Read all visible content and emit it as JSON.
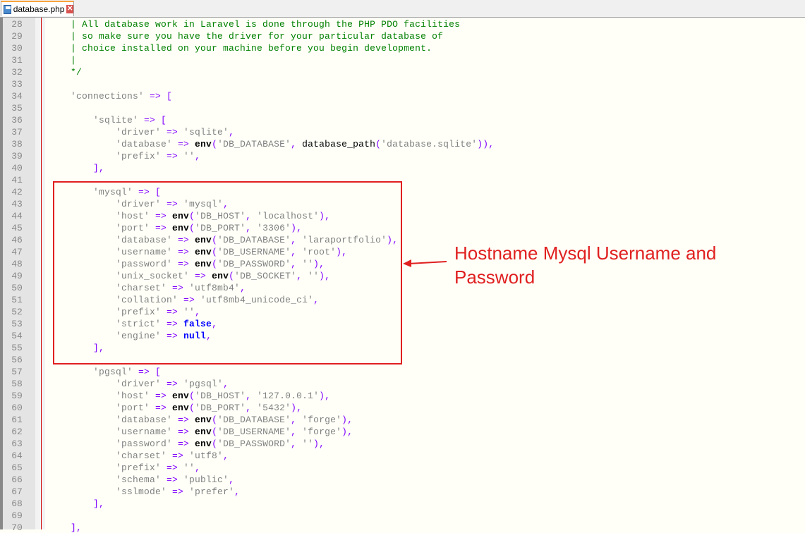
{
  "tab": {
    "title": "database.php",
    "icon": "save-icon",
    "close": "close-icon"
  },
  "annotation": {
    "text_line1": "Hostname Mysql Username and",
    "text_line2": "Password",
    "color": "#e02020"
  },
  "first_line_number": 28,
  "lines": [
    [
      [
        "c",
        "    | All database work in Laravel is done through the PHP PDO facilities"
      ]
    ],
    [
      [
        "c",
        "    | so make sure you have the driver for your particular database of"
      ]
    ],
    [
      [
        "c",
        "    | choice installed on your machine before you begin development."
      ]
    ],
    [
      [
        "c",
        "    |"
      ]
    ],
    [
      [
        "c",
        "    */"
      ]
    ],
    [],
    [
      [
        "s",
        "    'connections'"
      ],
      [
        "o",
        " => ["
      ]
    ],
    [],
    [
      [
        "s",
        "        'sqlite'"
      ],
      [
        "o",
        " => ["
      ]
    ],
    [
      [
        "s",
        "            'driver'"
      ],
      [
        "o",
        " => "
      ],
      [
        "s",
        "'sqlite'"
      ],
      [
        "o",
        ","
      ]
    ],
    [
      [
        "s",
        "            'database'"
      ],
      [
        "o",
        " => "
      ],
      [
        "f",
        "env"
      ],
      [
        "o",
        "("
      ],
      [
        "s",
        "'DB_DATABASE'"
      ],
      [
        "o",
        ", "
      ],
      [
        "p",
        "database_path"
      ],
      [
        "o",
        "("
      ],
      [
        "s",
        "'database.sqlite'"
      ],
      [
        "o",
        ")),"
      ]
    ],
    [
      [
        "s",
        "            'prefix'"
      ],
      [
        "o",
        " => "
      ],
      [
        "s",
        "''"
      ],
      [
        "o",
        ","
      ]
    ],
    [
      [
        "o",
        "        ],"
      ]
    ],
    [],
    [
      [
        "s",
        "        'mysql'"
      ],
      [
        "o",
        " => ["
      ]
    ],
    [
      [
        "s",
        "            'driver'"
      ],
      [
        "o",
        " => "
      ],
      [
        "s",
        "'mysql'"
      ],
      [
        "o",
        ","
      ]
    ],
    [
      [
        "s",
        "            'host'"
      ],
      [
        "o",
        " => "
      ],
      [
        "f",
        "env"
      ],
      [
        "o",
        "("
      ],
      [
        "s",
        "'DB_HOST'"
      ],
      [
        "o",
        ", "
      ],
      [
        "s",
        "'localhost'"
      ],
      [
        "o",
        "),"
      ]
    ],
    [
      [
        "s",
        "            'port'"
      ],
      [
        "o",
        " => "
      ],
      [
        "f",
        "env"
      ],
      [
        "o",
        "("
      ],
      [
        "s",
        "'DB_PORT'"
      ],
      [
        "o",
        ", "
      ],
      [
        "s",
        "'3306'"
      ],
      [
        "o",
        "),"
      ]
    ],
    [
      [
        "s",
        "            'database'"
      ],
      [
        "o",
        " => "
      ],
      [
        "f",
        "env"
      ],
      [
        "o",
        "("
      ],
      [
        "s",
        "'DB_DATABASE'"
      ],
      [
        "o",
        ", "
      ],
      [
        "s",
        "'laraportfolio'"
      ],
      [
        "o",
        "),"
      ]
    ],
    [
      [
        "s",
        "            'username'"
      ],
      [
        "o",
        " => "
      ],
      [
        "f",
        "env"
      ],
      [
        "o",
        "("
      ],
      [
        "s",
        "'DB_USERNAME'"
      ],
      [
        "o",
        ", "
      ],
      [
        "s",
        "'root'"
      ],
      [
        "o",
        "),"
      ]
    ],
    [
      [
        "s",
        "            'password'"
      ],
      [
        "o",
        " => "
      ],
      [
        "f",
        "env"
      ],
      [
        "o",
        "("
      ],
      [
        "s",
        "'DB_PASSWORD'"
      ],
      [
        "o",
        ", "
      ],
      [
        "s",
        "''"
      ],
      [
        "o",
        "),"
      ]
    ],
    [
      [
        "s",
        "            'unix_socket'"
      ],
      [
        "o",
        " => "
      ],
      [
        "f",
        "env"
      ],
      [
        "o",
        "("
      ],
      [
        "s",
        "'DB_SOCKET'"
      ],
      [
        "o",
        ", "
      ],
      [
        "s",
        "''"
      ],
      [
        "o",
        "),"
      ]
    ],
    [
      [
        "s",
        "            'charset'"
      ],
      [
        "o",
        " => "
      ],
      [
        "s",
        "'utf8mb4'"
      ],
      [
        "o",
        ","
      ]
    ],
    [
      [
        "s",
        "            'collation'"
      ],
      [
        "o",
        " => "
      ],
      [
        "s",
        "'utf8mb4_unicode_ci'"
      ],
      [
        "o",
        ","
      ]
    ],
    [
      [
        "s",
        "            'prefix'"
      ],
      [
        "o",
        " => "
      ],
      [
        "s",
        "''"
      ],
      [
        "o",
        ","
      ]
    ],
    [
      [
        "s",
        "            'strict'"
      ],
      [
        "o",
        " => "
      ],
      [
        "k",
        "false"
      ],
      [
        "o",
        ","
      ]
    ],
    [
      [
        "s",
        "            'engine'"
      ],
      [
        "o",
        " => "
      ],
      [
        "k",
        "null"
      ],
      [
        "o",
        ","
      ]
    ],
    [
      [
        "o",
        "        ],"
      ]
    ],
    [],
    [
      [
        "s",
        "        'pgsql'"
      ],
      [
        "o",
        " => ["
      ]
    ],
    [
      [
        "s",
        "            'driver'"
      ],
      [
        "o",
        " => "
      ],
      [
        "s",
        "'pgsql'"
      ],
      [
        "o",
        ","
      ]
    ],
    [
      [
        "s",
        "            'host'"
      ],
      [
        "o",
        " => "
      ],
      [
        "f",
        "env"
      ],
      [
        "o",
        "("
      ],
      [
        "s",
        "'DB_HOST'"
      ],
      [
        "o",
        ", "
      ],
      [
        "s",
        "'127.0.0.1'"
      ],
      [
        "o",
        "),"
      ]
    ],
    [
      [
        "s",
        "            'port'"
      ],
      [
        "o",
        " => "
      ],
      [
        "f",
        "env"
      ],
      [
        "o",
        "("
      ],
      [
        "s",
        "'DB_PORT'"
      ],
      [
        "o",
        ", "
      ],
      [
        "s",
        "'5432'"
      ],
      [
        "o",
        "),"
      ]
    ],
    [
      [
        "s",
        "            'database'"
      ],
      [
        "o",
        " => "
      ],
      [
        "f",
        "env"
      ],
      [
        "o",
        "("
      ],
      [
        "s",
        "'DB_DATABASE'"
      ],
      [
        "o",
        ", "
      ],
      [
        "s",
        "'forge'"
      ],
      [
        "o",
        "),"
      ]
    ],
    [
      [
        "s",
        "            'username'"
      ],
      [
        "o",
        " => "
      ],
      [
        "f",
        "env"
      ],
      [
        "o",
        "("
      ],
      [
        "s",
        "'DB_USERNAME'"
      ],
      [
        "o",
        ", "
      ],
      [
        "s",
        "'forge'"
      ],
      [
        "o",
        "),"
      ]
    ],
    [
      [
        "s",
        "            'password'"
      ],
      [
        "o",
        " => "
      ],
      [
        "f",
        "env"
      ],
      [
        "o",
        "("
      ],
      [
        "s",
        "'DB_PASSWORD'"
      ],
      [
        "o",
        ", "
      ],
      [
        "s",
        "''"
      ],
      [
        "o",
        "),"
      ]
    ],
    [
      [
        "s",
        "            'charset'"
      ],
      [
        "o",
        " => "
      ],
      [
        "s",
        "'utf8'"
      ],
      [
        "o",
        ","
      ]
    ],
    [
      [
        "s",
        "            'prefix'"
      ],
      [
        "o",
        " => "
      ],
      [
        "s",
        "''"
      ],
      [
        "o",
        ","
      ]
    ],
    [
      [
        "s",
        "            'schema'"
      ],
      [
        "o",
        " => "
      ],
      [
        "s",
        "'public'"
      ],
      [
        "o",
        ","
      ]
    ],
    [
      [
        "s",
        "            'sslmode'"
      ],
      [
        "o",
        " => "
      ],
      [
        "s",
        "'prefer'"
      ],
      [
        "o",
        ","
      ]
    ],
    [
      [
        "o",
        "        ],"
      ]
    ],
    [],
    [
      [
        "o",
        "    ],"
      ]
    ]
  ]
}
